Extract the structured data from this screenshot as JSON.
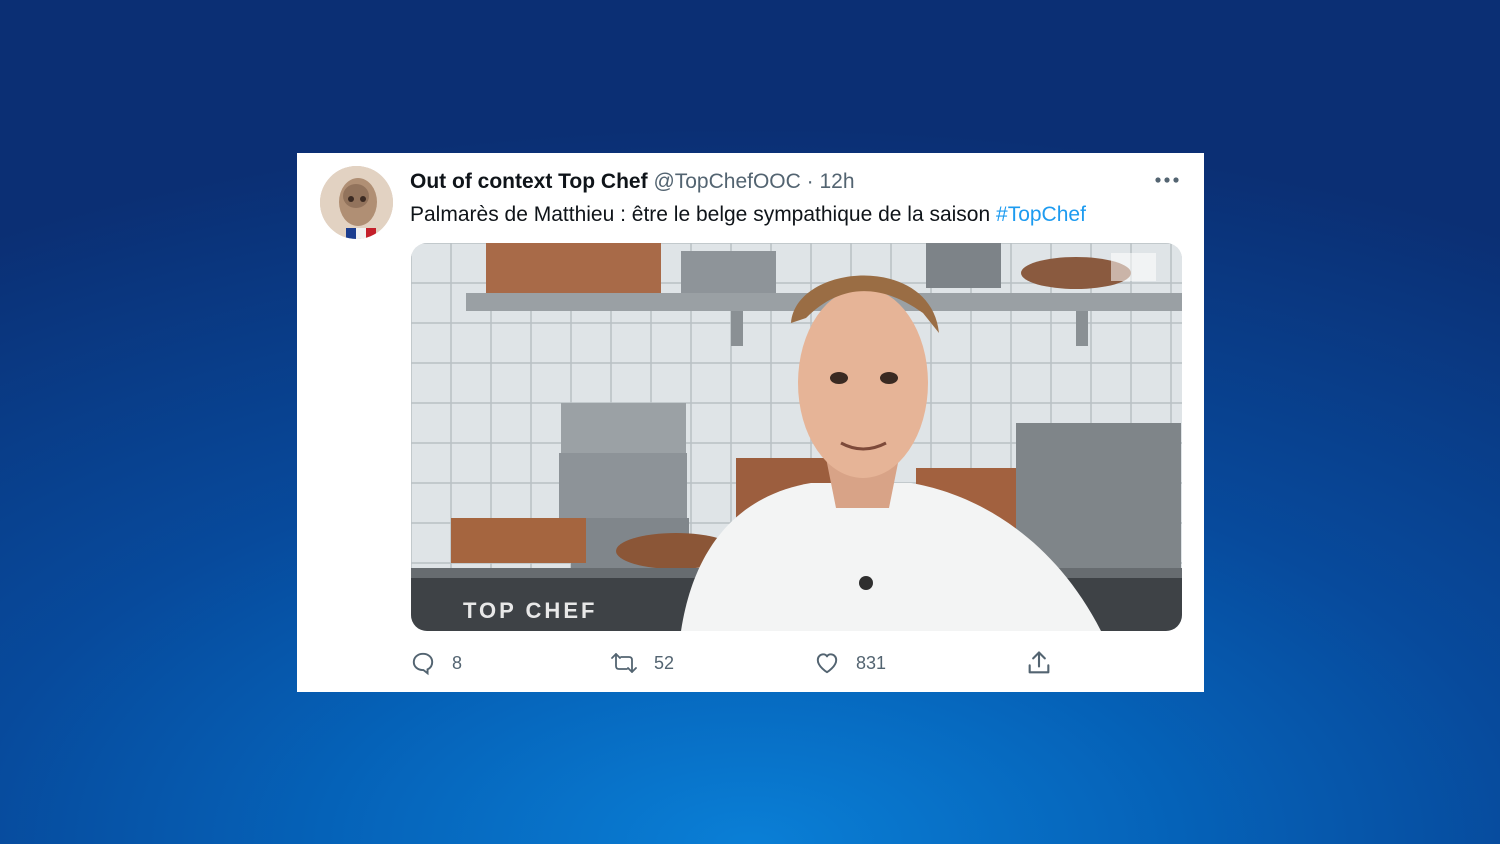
{
  "tweet": {
    "display_name": "Out of context Top Chef",
    "handle": "@TopChefOOC",
    "separator": "·",
    "time": "12h",
    "text": "Palmarès de Matthieu : être le belge sympathique de la saison",
    "hashtag": "#TopChef",
    "media_watermark": "TOP CHEF",
    "replies": "8",
    "retweets": "52",
    "likes": "831"
  },
  "colors": {
    "accent": "#1d9bf0",
    "text_primary": "#0f1419",
    "text_secondary": "#536471"
  },
  "icons": [
    "more-icon",
    "reply-icon",
    "retweet-icon",
    "like-icon",
    "share-icon",
    "channel-logo-icon"
  ]
}
